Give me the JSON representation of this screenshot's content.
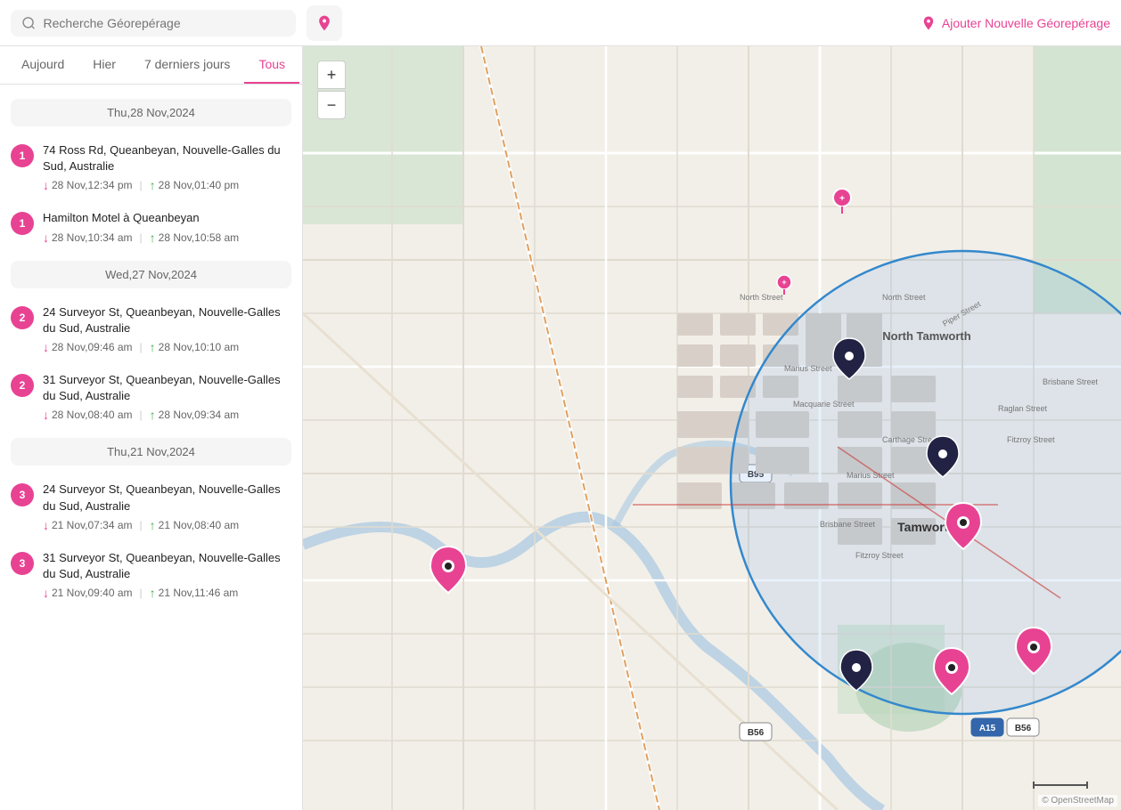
{
  "topbar": {
    "search_placeholder": "Recherche Géorepérage",
    "add_btn_label": "Ajouter Nouvelle Géorepérage"
  },
  "tabs": [
    {
      "label": "Aujourd",
      "active": false
    },
    {
      "label": "Hier",
      "active": false
    },
    {
      "label": "7 derniers jours",
      "active": false
    },
    {
      "label": "Tous",
      "active": true
    }
  ],
  "dates": [
    {
      "label": "Thu,28 Nov,2024",
      "items": [
        {
          "number": "1",
          "address": "74 Ross Rd, Queanbeyan, Nouvelle-Galles du Sud, Australie",
          "arrive_date": "28 Nov",
          "arrive_time": "12:34 pm",
          "leave_date": "28 Nov",
          "leave_time": "01:40 pm"
        },
        {
          "number": "1",
          "address": "Hamilton Motel à Queanbeyan",
          "arrive_date": "28 Nov",
          "arrive_time": "10:34 am",
          "leave_date": "28 Nov",
          "leave_time": "10:58 am"
        }
      ]
    },
    {
      "label": "Wed,27 Nov,2024",
      "items": [
        {
          "number": "2",
          "address": "24 Surveyor St, Queanbeyan, Nouvelle-Galles du Sud, Australie",
          "arrive_date": "28 Nov",
          "arrive_time": "09:46 am",
          "leave_date": "28 Nov",
          "leave_time": "10:10 am"
        },
        {
          "number": "2",
          "address": "31 Surveyor St, Queanbeyan, Nouvelle-Galles du Sud, Australie",
          "arrive_date": "28 Nov",
          "arrive_time": "08:40 am",
          "leave_date": "28 Nov",
          "leave_time": "09:34 am"
        }
      ]
    },
    {
      "label": "Thu,21 Nov,2024",
      "items": [
        {
          "number": "3",
          "address": "24 Surveyor St, Queanbeyan, Nouvelle-Galles du Sud, Australie",
          "arrive_date": "21 Nov",
          "arrive_time": "07:34 am",
          "leave_date": "21 Nov",
          "leave_time": "08:40 am"
        },
        {
          "number": "3",
          "address": "31 Surveyor St, Queanbeyan, Nouvelle-Galles du Sud, Australie",
          "arrive_date": "21 Nov",
          "arrive_time": "09:40 am",
          "leave_date": "21 Nov",
          "leave_time": "11:46 am"
        }
      ]
    }
  ],
  "map_controls": {
    "zoom_in": "+",
    "zoom_out": "−"
  },
  "colors": {
    "accent": "#e84393",
    "green": "#4caf50",
    "geofence_fill": "rgba(100,160,230,0.2)",
    "geofence_stroke": "#3388cc"
  }
}
